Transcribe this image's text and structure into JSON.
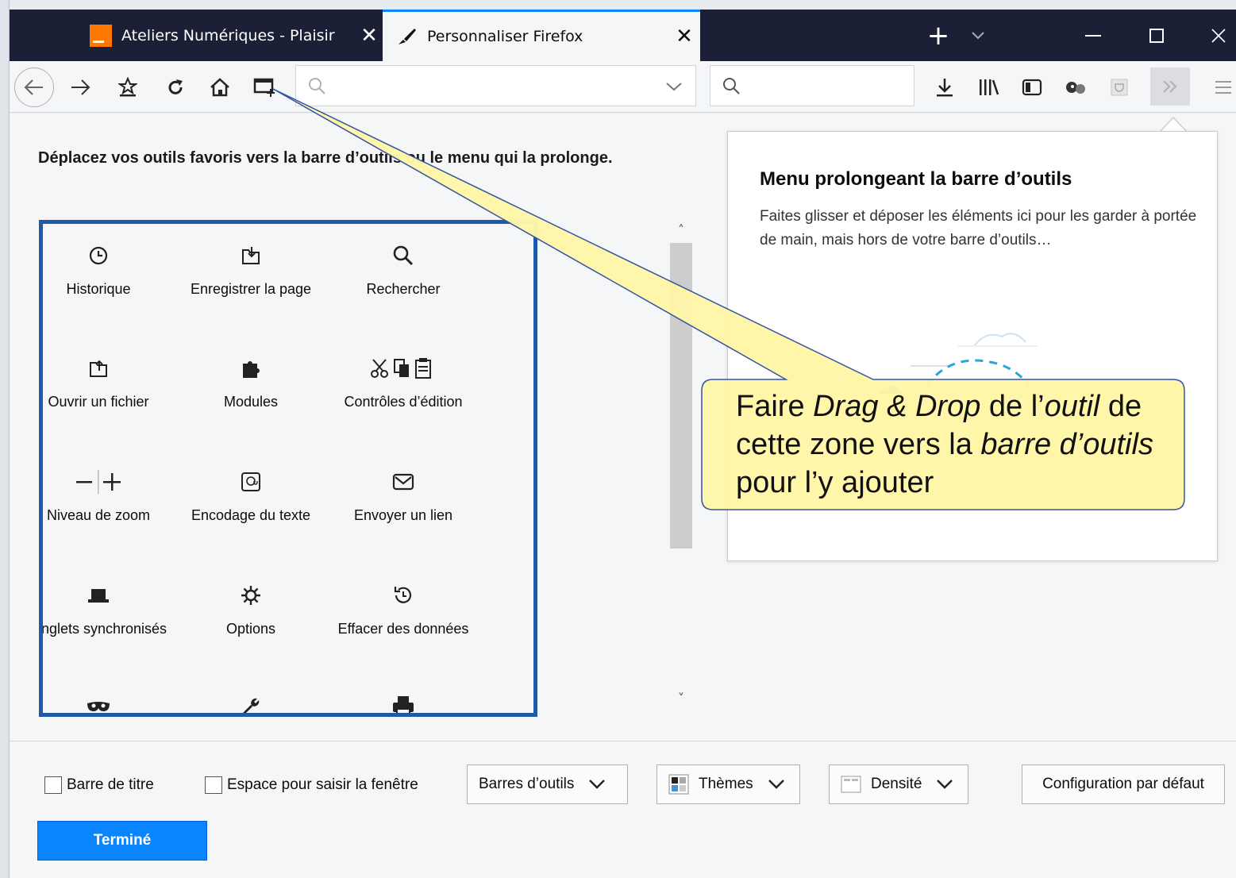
{
  "tabs": [
    {
      "title": "Ateliers Numériques - Plaisir",
      "icon": "orange-logo-icon"
    },
    {
      "title": "Personnaliser Firefox",
      "icon": "paintbrush-icon"
    }
  ],
  "titlebar": {
    "new_tab": "+"
  },
  "instructions": "Déplacez vos outils favoris vers la barre d’outils ou le menu qui la prolonge.",
  "palette": [
    {
      "label": "Historique",
      "icon": "clock-icon"
    },
    {
      "label": "Enregistrer la page",
      "icon": "save-page-icon"
    },
    {
      "label": "Rechercher",
      "icon": "search-icon"
    },
    {
      "label": "Ouvrir un fichier",
      "icon": "open-file-icon"
    },
    {
      "label": "Modules",
      "icon": "puzzle-icon"
    },
    {
      "label": "Contrôles d’édition",
      "icon": "cut-copy-paste-icon"
    },
    {
      "label": "Niveau de zoom",
      "icon": "zoom-controls-icon"
    },
    {
      "label": "Encodage du texte",
      "icon": "text-encoding-icon"
    },
    {
      "label": "Envoyer un lien",
      "icon": "envelope-icon"
    },
    {
      "label": "Onglets synchronisés",
      "icon": "synced-tabs-icon"
    },
    {
      "label": "Options",
      "icon": "gear-icon"
    },
    {
      "label": "Effacer des données",
      "icon": "forget-history-icon"
    },
    {
      "label": "",
      "icon": "private-mask-icon"
    },
    {
      "label": "",
      "icon": "wrench-icon"
    },
    {
      "label": "",
      "icon": "printer-icon"
    }
  ],
  "overflow": {
    "title": "Menu prolongeant la barre d’outils",
    "description": "Faites glisser et déposer les éléments ici pour les garder à portée de main, mais hors de votre barre d’outils…"
  },
  "footer": {
    "title_bar_label": "Barre de titre",
    "drag_space_label": "Espace pour saisir la fenêtre",
    "toolbars_label": "Barres d’outils",
    "themes_label": "Thèmes",
    "density_label": "Densité",
    "reset_label": "Configuration par défaut",
    "done_label": "Terminé"
  },
  "callout": {
    "p1": "Faire ",
    "i1": "Drag & Drop",
    "p2": " de l’",
    "i2": "outil",
    "p3": " de cette zone vers la ",
    "i3": "barre d’outils",
    "p4": " pour l’y ajouter"
  },
  "colors": {
    "accent": "#0a84ff",
    "tabstrip": "#1c2037",
    "palette_border": "#1f5aa8",
    "callout_fill": "#fff6a8"
  }
}
